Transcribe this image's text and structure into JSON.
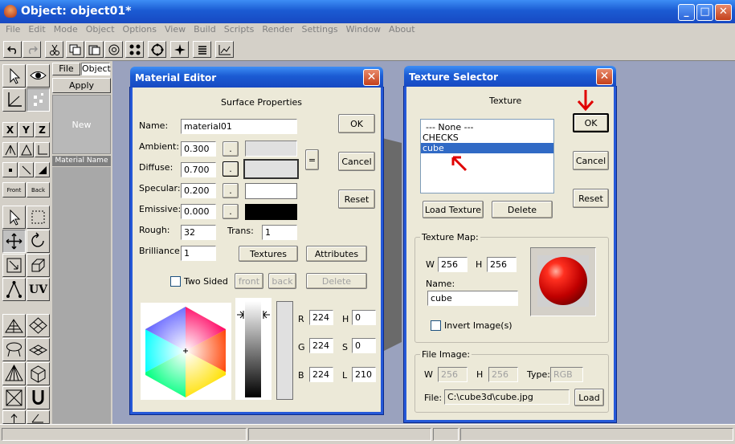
{
  "window": {
    "title": "Object: object01*"
  },
  "menu": [
    "File",
    "Edit",
    "Mode",
    "Object",
    "Options",
    "View",
    "Build",
    "Scripts",
    "Render",
    "Settings",
    "Window",
    "About"
  ],
  "left_panel": {
    "file_tab": "File",
    "object_tab": "Object",
    "apply": "Apply",
    "new": "New",
    "material_name": "Material Name"
  },
  "toolbar_left": {
    "front": "Front",
    "back": "Back",
    "x": "X",
    "y": "Y",
    "z": "Z",
    "uv": "UV"
  },
  "material_editor": {
    "title": "Material Editor",
    "section": "Surface Properties",
    "name_label": "Name:",
    "name_value": "material01",
    "ambient_label": "Ambient:",
    "ambient_value": "0.300",
    "diffuse_label": "Diffuse:",
    "diffuse_value": "0.700",
    "specular_label": "Specular:",
    "specular_value": "0.200",
    "emissive_label": "Emissive:",
    "emissive_value": "0.000",
    "rough_label": "Rough:",
    "rough_value": "32",
    "trans_label": "Trans:",
    "trans_value": "1",
    "brilliance_label": "Brilliance:",
    "brilliance_value": "1",
    "dot": ".",
    "equals": "=",
    "ok": "OK",
    "cancel": "Cancel",
    "reset": "Reset",
    "textures": "Textures",
    "attributes": "Attributes",
    "two_sided": "Two Sided",
    "front": "front",
    "back": "back",
    "delete": "Delete",
    "r_label": "R",
    "r_value": "224",
    "g_label": "G",
    "g_value": "224",
    "b_label": "B",
    "b_value": "224",
    "h_label": "H",
    "h_value": "0",
    "s_label": "S",
    "s_value": "0",
    "l_label": "L",
    "l_value": "210",
    "colors": {
      "ambient": "#e0e0e0",
      "diffuse": "#e0e0e0",
      "specular": "#ffffff",
      "emissive": "#000000"
    }
  },
  "texture_selector": {
    "title": "Texture Selector",
    "section": "Texture",
    "list": [
      "--- None ---",
      "CHECKS",
      "cube"
    ],
    "selected": "cube",
    "ok": "OK",
    "cancel": "Cancel",
    "reset": "Reset",
    "load_texture": "Load Texture",
    "delete": "Delete",
    "texture_map_label": "Texture Map:",
    "w_label": "W",
    "w_value": "256",
    "h_label": "H",
    "h_value": "256",
    "name_label": "Name:",
    "name_value": "cube",
    "invert": "Invert Image(s)",
    "file_image_label": "File Image:",
    "fi_w_value": "256",
    "fi_h_value": "256",
    "type_label": "Type:",
    "type_value": "RGB",
    "file_label": "File:",
    "file_value": "C:\\cube3d\\cube.jpg",
    "load": "Load"
  },
  "titlebar_buttons": {
    "close": "✕",
    "minimize": "_",
    "maximize": "□"
  }
}
